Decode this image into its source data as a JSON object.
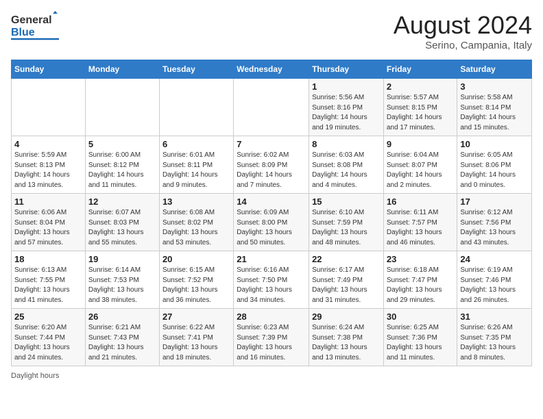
{
  "header": {
    "logo_line1": "General",
    "logo_line2": "Blue",
    "month_year": "August 2024",
    "location": "Serino, Campania, Italy"
  },
  "days_of_week": [
    "Sunday",
    "Monday",
    "Tuesday",
    "Wednesday",
    "Thursday",
    "Friday",
    "Saturday"
  ],
  "weeks": [
    [
      {
        "day": "",
        "info": ""
      },
      {
        "day": "",
        "info": ""
      },
      {
        "day": "",
        "info": ""
      },
      {
        "day": "",
        "info": ""
      },
      {
        "day": "1",
        "info": "Sunrise: 5:56 AM\nSunset: 8:16 PM\nDaylight: 14 hours\nand 19 minutes."
      },
      {
        "day": "2",
        "info": "Sunrise: 5:57 AM\nSunset: 8:15 PM\nDaylight: 14 hours\nand 17 minutes."
      },
      {
        "day": "3",
        "info": "Sunrise: 5:58 AM\nSunset: 8:14 PM\nDaylight: 14 hours\nand 15 minutes."
      }
    ],
    [
      {
        "day": "4",
        "info": "Sunrise: 5:59 AM\nSunset: 8:13 PM\nDaylight: 14 hours\nand 13 minutes."
      },
      {
        "day": "5",
        "info": "Sunrise: 6:00 AM\nSunset: 8:12 PM\nDaylight: 14 hours\nand 11 minutes."
      },
      {
        "day": "6",
        "info": "Sunrise: 6:01 AM\nSunset: 8:11 PM\nDaylight: 14 hours\nand 9 minutes."
      },
      {
        "day": "7",
        "info": "Sunrise: 6:02 AM\nSunset: 8:09 PM\nDaylight: 14 hours\nand 7 minutes."
      },
      {
        "day": "8",
        "info": "Sunrise: 6:03 AM\nSunset: 8:08 PM\nDaylight: 14 hours\nand 4 minutes."
      },
      {
        "day": "9",
        "info": "Sunrise: 6:04 AM\nSunset: 8:07 PM\nDaylight: 14 hours\nand 2 minutes."
      },
      {
        "day": "10",
        "info": "Sunrise: 6:05 AM\nSunset: 8:06 PM\nDaylight: 14 hours\nand 0 minutes."
      }
    ],
    [
      {
        "day": "11",
        "info": "Sunrise: 6:06 AM\nSunset: 8:04 PM\nDaylight: 13 hours\nand 57 minutes."
      },
      {
        "day": "12",
        "info": "Sunrise: 6:07 AM\nSunset: 8:03 PM\nDaylight: 13 hours\nand 55 minutes."
      },
      {
        "day": "13",
        "info": "Sunrise: 6:08 AM\nSunset: 8:02 PM\nDaylight: 13 hours\nand 53 minutes."
      },
      {
        "day": "14",
        "info": "Sunrise: 6:09 AM\nSunset: 8:00 PM\nDaylight: 13 hours\nand 50 minutes."
      },
      {
        "day": "15",
        "info": "Sunrise: 6:10 AM\nSunset: 7:59 PM\nDaylight: 13 hours\nand 48 minutes."
      },
      {
        "day": "16",
        "info": "Sunrise: 6:11 AM\nSunset: 7:57 PM\nDaylight: 13 hours\nand 46 minutes."
      },
      {
        "day": "17",
        "info": "Sunrise: 6:12 AM\nSunset: 7:56 PM\nDaylight: 13 hours\nand 43 minutes."
      }
    ],
    [
      {
        "day": "18",
        "info": "Sunrise: 6:13 AM\nSunset: 7:55 PM\nDaylight: 13 hours\nand 41 minutes."
      },
      {
        "day": "19",
        "info": "Sunrise: 6:14 AM\nSunset: 7:53 PM\nDaylight: 13 hours\nand 38 minutes."
      },
      {
        "day": "20",
        "info": "Sunrise: 6:15 AM\nSunset: 7:52 PM\nDaylight: 13 hours\nand 36 minutes."
      },
      {
        "day": "21",
        "info": "Sunrise: 6:16 AM\nSunset: 7:50 PM\nDaylight: 13 hours\nand 34 minutes."
      },
      {
        "day": "22",
        "info": "Sunrise: 6:17 AM\nSunset: 7:49 PM\nDaylight: 13 hours\nand 31 minutes."
      },
      {
        "day": "23",
        "info": "Sunrise: 6:18 AM\nSunset: 7:47 PM\nDaylight: 13 hours\nand 29 minutes."
      },
      {
        "day": "24",
        "info": "Sunrise: 6:19 AM\nSunset: 7:46 PM\nDaylight: 13 hours\nand 26 minutes."
      }
    ],
    [
      {
        "day": "25",
        "info": "Sunrise: 6:20 AM\nSunset: 7:44 PM\nDaylight: 13 hours\nand 24 minutes."
      },
      {
        "day": "26",
        "info": "Sunrise: 6:21 AM\nSunset: 7:43 PM\nDaylight: 13 hours\nand 21 minutes."
      },
      {
        "day": "27",
        "info": "Sunrise: 6:22 AM\nSunset: 7:41 PM\nDaylight: 13 hours\nand 18 minutes."
      },
      {
        "day": "28",
        "info": "Sunrise: 6:23 AM\nSunset: 7:39 PM\nDaylight: 13 hours\nand 16 minutes."
      },
      {
        "day": "29",
        "info": "Sunrise: 6:24 AM\nSunset: 7:38 PM\nDaylight: 13 hours\nand 13 minutes."
      },
      {
        "day": "30",
        "info": "Sunrise: 6:25 AM\nSunset: 7:36 PM\nDaylight: 13 hours\nand 11 minutes."
      },
      {
        "day": "31",
        "info": "Sunrise: 6:26 AM\nSunset: 7:35 PM\nDaylight: 13 hours\nand 8 minutes."
      }
    ]
  ],
  "footer": {
    "daylight_label": "Daylight hours"
  }
}
